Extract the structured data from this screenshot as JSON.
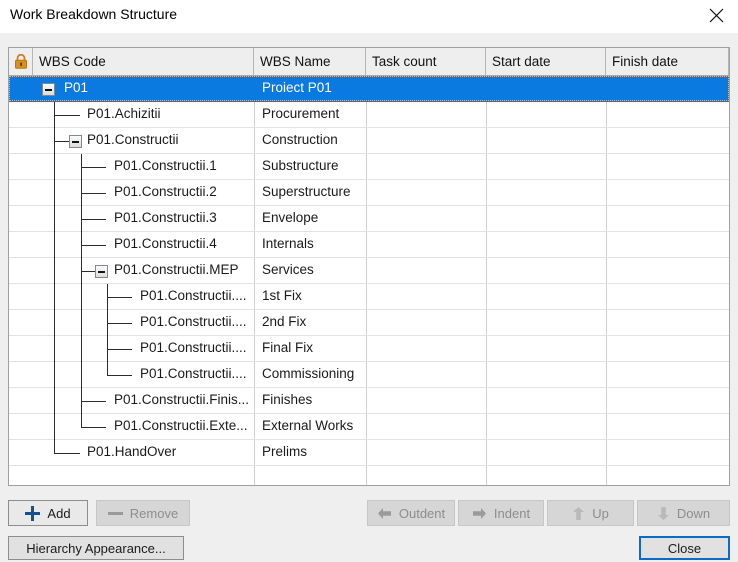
{
  "window": {
    "title": "Work Breakdown Structure",
    "close_icon": "close-icon"
  },
  "grid": {
    "lock_icon": "lock-icon",
    "columns": [
      {
        "key": "wbs_code",
        "label": "WBS Code"
      },
      {
        "key": "wbs_name",
        "label": "WBS Name"
      },
      {
        "key": "task_count",
        "label": "Task count"
      },
      {
        "key": "start_date",
        "label": "Start date"
      },
      {
        "key": "finish_date",
        "label": "Finish date"
      }
    ],
    "rows": [
      {
        "code": "P01",
        "name": "Proiect P01",
        "level": 0,
        "expander": "collapse",
        "selected": true,
        "task_count": "",
        "start_date": "",
        "finish_date": ""
      },
      {
        "code": "P01.Achizitii",
        "name": "Procurement",
        "level": 1,
        "expander": "none",
        "selected": false,
        "task_count": "",
        "start_date": "",
        "finish_date": ""
      },
      {
        "code": "P01.Constructii",
        "name": "Construction",
        "level": 1,
        "expander": "collapse",
        "selected": false,
        "task_count": "",
        "start_date": "",
        "finish_date": ""
      },
      {
        "code": "P01.Constructii.1",
        "name": "Substructure",
        "level": 2,
        "expander": "none",
        "selected": false,
        "task_count": "",
        "start_date": "",
        "finish_date": ""
      },
      {
        "code": "P01.Constructii.2",
        "name": "Superstructure",
        "level": 2,
        "expander": "none",
        "selected": false,
        "task_count": "",
        "start_date": "",
        "finish_date": ""
      },
      {
        "code": "P01.Constructii.3",
        "name": "Envelope",
        "level": 2,
        "expander": "none",
        "selected": false,
        "task_count": "",
        "start_date": "",
        "finish_date": ""
      },
      {
        "code": "P01.Constructii.4",
        "name": "Internals",
        "level": 2,
        "expander": "none",
        "selected": false,
        "task_count": "",
        "start_date": "",
        "finish_date": ""
      },
      {
        "code": "P01.Constructii.MEP",
        "name": "Services",
        "level": 2,
        "expander": "collapse",
        "selected": false,
        "task_count": "",
        "start_date": "",
        "finish_date": ""
      },
      {
        "code": "P01.Constructii....",
        "name": "1st Fix",
        "level": 3,
        "expander": "none",
        "selected": false,
        "task_count": "",
        "start_date": "",
        "finish_date": ""
      },
      {
        "code": "P01.Constructii....",
        "name": "2nd Fix",
        "level": 3,
        "expander": "none",
        "selected": false,
        "task_count": "",
        "start_date": "",
        "finish_date": ""
      },
      {
        "code": "P01.Constructii....",
        "name": "Final Fix",
        "level": 3,
        "expander": "none",
        "selected": false,
        "task_count": "",
        "start_date": "",
        "finish_date": ""
      },
      {
        "code": "P01.Constructii....",
        "name": "Commissioning",
        "level": 3,
        "expander": "none",
        "selected": false,
        "task_count": "",
        "start_date": "",
        "finish_date": ""
      },
      {
        "code": "P01.Constructii.Finis...",
        "name": "Finishes",
        "level": 2,
        "expander": "none",
        "selected": false,
        "task_count": "",
        "start_date": "",
        "finish_date": ""
      },
      {
        "code": "P01.Constructii.Exte...",
        "name": "External Works",
        "level": 2,
        "expander": "none",
        "selected": false,
        "task_count": "",
        "start_date": "",
        "finish_date": ""
      },
      {
        "code": "P01.HandOver",
        "name": "Prelims",
        "level": 1,
        "expander": "none",
        "selected": false,
        "task_count": "",
        "start_date": "",
        "finish_date": ""
      }
    ]
  },
  "toolbar": {
    "add_label": "Add",
    "remove_label": "Remove",
    "outdent_label": "Outdent",
    "indent_label": "Indent",
    "up_label": "Up",
    "down_label": "Down",
    "hierarchy_label": "Hierarchy Appearance...",
    "close_label": "Close"
  },
  "colors": {
    "selection": "#0a7ae0",
    "lock": "#d08020",
    "accent": "#0a6cc4"
  }
}
